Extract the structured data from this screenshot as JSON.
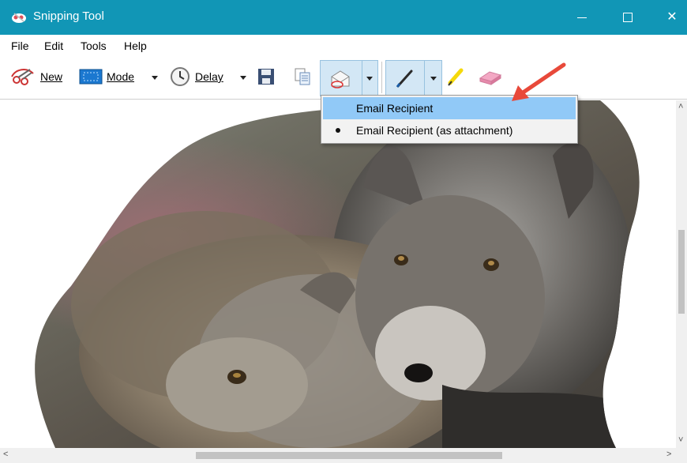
{
  "window": {
    "title": "Snipping Tool",
    "title_bar_color": "#1196b6",
    "controls": {
      "minimize": "minimize-icon",
      "maximize": "maximize-icon",
      "close": "✕"
    }
  },
  "menu": [
    "File",
    "Edit",
    "Tools",
    "Help"
  ],
  "toolbar": {
    "new_label": "New",
    "mode_label": "Mode",
    "delay_label": "Delay",
    "icons": [
      "scissors-icon",
      "mode-icon",
      "clock-icon",
      "save-icon",
      "copy-icon",
      "send-email-icon",
      "pen-icon",
      "highlighter-icon",
      "eraser-icon"
    ]
  },
  "send_menu": {
    "items": [
      {
        "label": "Email Recipient",
        "highlighted": true,
        "bullet": false
      },
      {
        "label": "Email Recipient (as attachment)",
        "highlighted": false,
        "bullet": true
      }
    ]
  },
  "canvas": {
    "content": "fox-photo"
  },
  "scrollbars": {
    "up": "˄",
    "down": "˅",
    "left": "<",
    "right": ">"
  },
  "annotation": {
    "arrow_color": "#e8493a"
  }
}
